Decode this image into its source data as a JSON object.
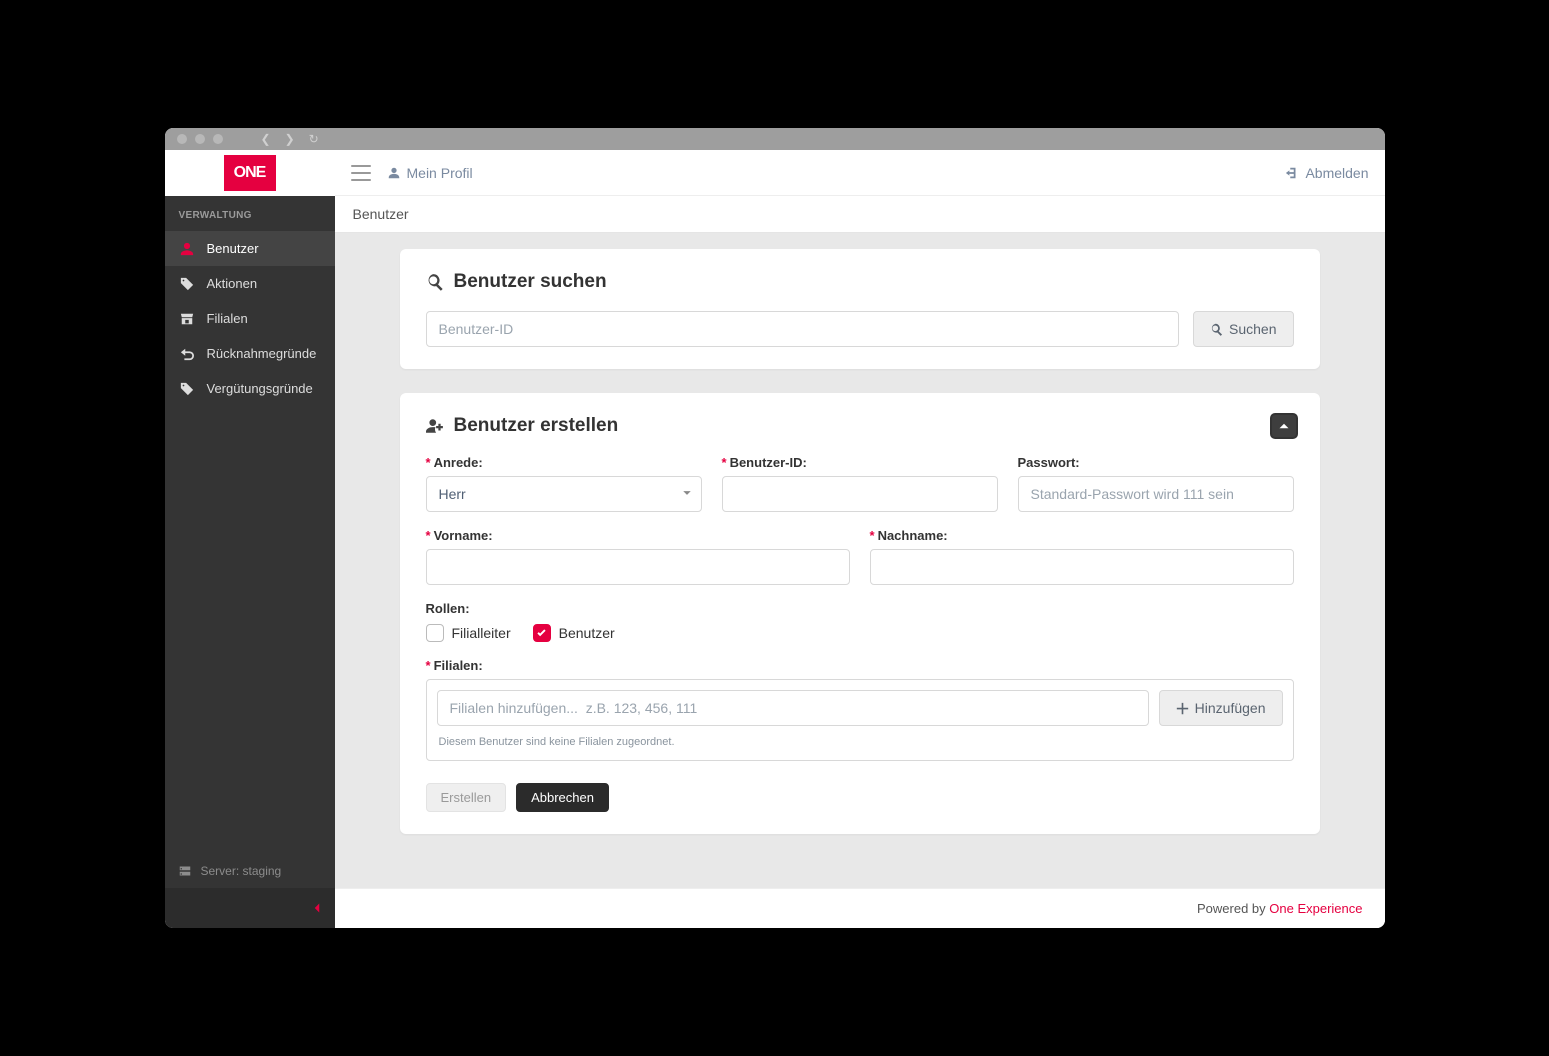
{
  "logo_text": "ONE",
  "topbar": {
    "profile": "Mein Profil",
    "logout": "Abmelden"
  },
  "sidebar": {
    "section": "VERWALTUNG",
    "items": [
      {
        "label": "Benutzer",
        "active": true
      },
      {
        "label": "Aktionen"
      },
      {
        "label": "Filialen"
      },
      {
        "label": "Rücknahmegründe"
      },
      {
        "label": "Vergütungsgründe"
      }
    ],
    "server_label": "Server: staging"
  },
  "breadcrumb": "Benutzer",
  "search_card": {
    "title": "Benutzer suchen",
    "placeholder": "Benutzer-ID",
    "button": "Suchen"
  },
  "create_card": {
    "title": "Benutzer erstellen",
    "fields": {
      "anrede_label": "Anrede:",
      "anrede_value": "Herr",
      "benutzer_id_label": "Benutzer-ID:",
      "passwort_label": "Passwort:",
      "passwort_placeholder": "Standard-Passwort wird 111 sein",
      "vorname_label": "Vorname:",
      "nachname_label": "Nachname:",
      "rollen_label": "Rollen:",
      "role_filialleiter": "Filialleiter",
      "role_benutzer": "Benutzer",
      "filialen_label": "Filialen:",
      "filialen_placeholder": "Filialen hinzufügen...  z.B. 123, 456, 111",
      "filialen_add": "Hinzufügen",
      "filialen_help": "Diesem Benutzer sind keine Filialen zugeordnet."
    },
    "actions": {
      "create": "Erstellen",
      "cancel": "Abbrechen"
    }
  },
  "footer": {
    "prefix": "Powered by ",
    "link": "One Experience"
  }
}
